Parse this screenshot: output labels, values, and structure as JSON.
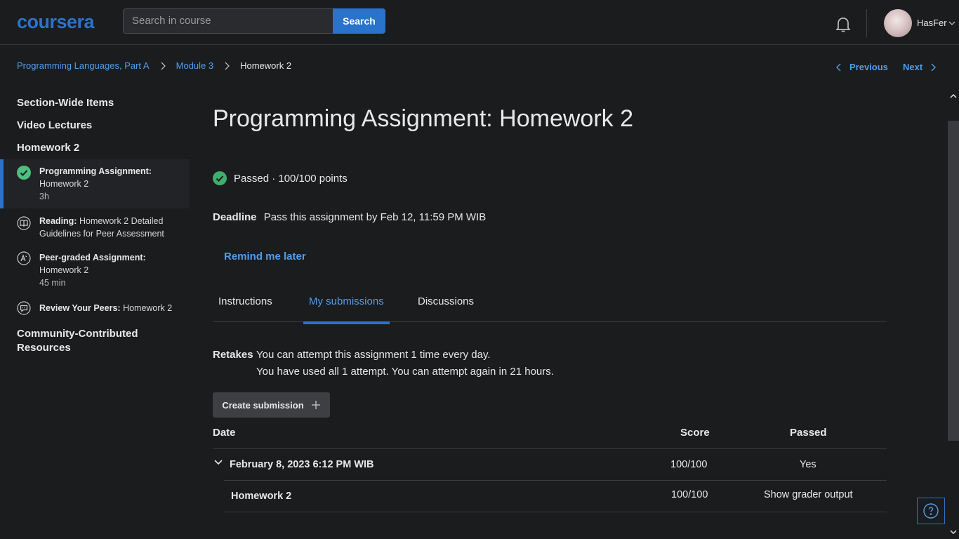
{
  "header": {
    "logo": "coursera",
    "search_placeholder": "Search in course",
    "search_button": "Search",
    "username": "HasFer"
  },
  "breadcrumb": {
    "items": [
      "Programming Languages, Part A",
      "Module 3",
      "Homework 2"
    ],
    "previous": "Previous",
    "next": "Next"
  },
  "sidebar": {
    "sections": [
      "Section-Wide Items",
      "Video Lectures",
      "Homework 2",
      "Community-Contributed Resources"
    ],
    "items": [
      {
        "type": "Programming Assignment:",
        "name": "Homework 2",
        "duration": "3h",
        "icon": "check-circle-icon",
        "active": true
      },
      {
        "type": "Reading:",
        "name": "Homework 2 Detailed Guidelines for Peer Assessment",
        "duration": "",
        "icon": "book-icon"
      },
      {
        "type": "Peer-graded Assignment:",
        "name": "Homework 2",
        "duration": "45 min",
        "icon": "peer-graded-icon"
      },
      {
        "type": "Review Your Peers:",
        "name": "Homework 2",
        "duration": "",
        "icon": "review-chat-icon"
      }
    ]
  },
  "main": {
    "title": "Programming Assignment: Homework 2",
    "status": "Passed · 100/100 points",
    "deadline_label": "Deadline",
    "deadline_text": "Pass this assignment by Feb 12, 11:59 PM WIB",
    "remind": "Remind me later",
    "tabs": [
      "Instructions",
      "My submissions",
      "Discussions"
    ],
    "retakes_label": "Retakes",
    "retakes_line1": "You can attempt this assignment 1 time every day.",
    "retakes_line2": "You have used all 1 attempt. You can attempt again in 21 hours.",
    "create_button": "Create submission",
    "table": {
      "headers": [
        "Date",
        "Score",
        "Passed"
      ],
      "row": {
        "date": "February 8, 2023 6:12 PM WIB",
        "score": "100/100",
        "passed": "Yes"
      },
      "subrow": {
        "name": "Homework 2",
        "score": "100/100",
        "action": "Show grader output"
      }
    }
  },
  "colors": {
    "accent": "#2a73cc",
    "link": "#4f9eef",
    "success": "#1f8a5b",
    "background": "#1b1c1e"
  }
}
